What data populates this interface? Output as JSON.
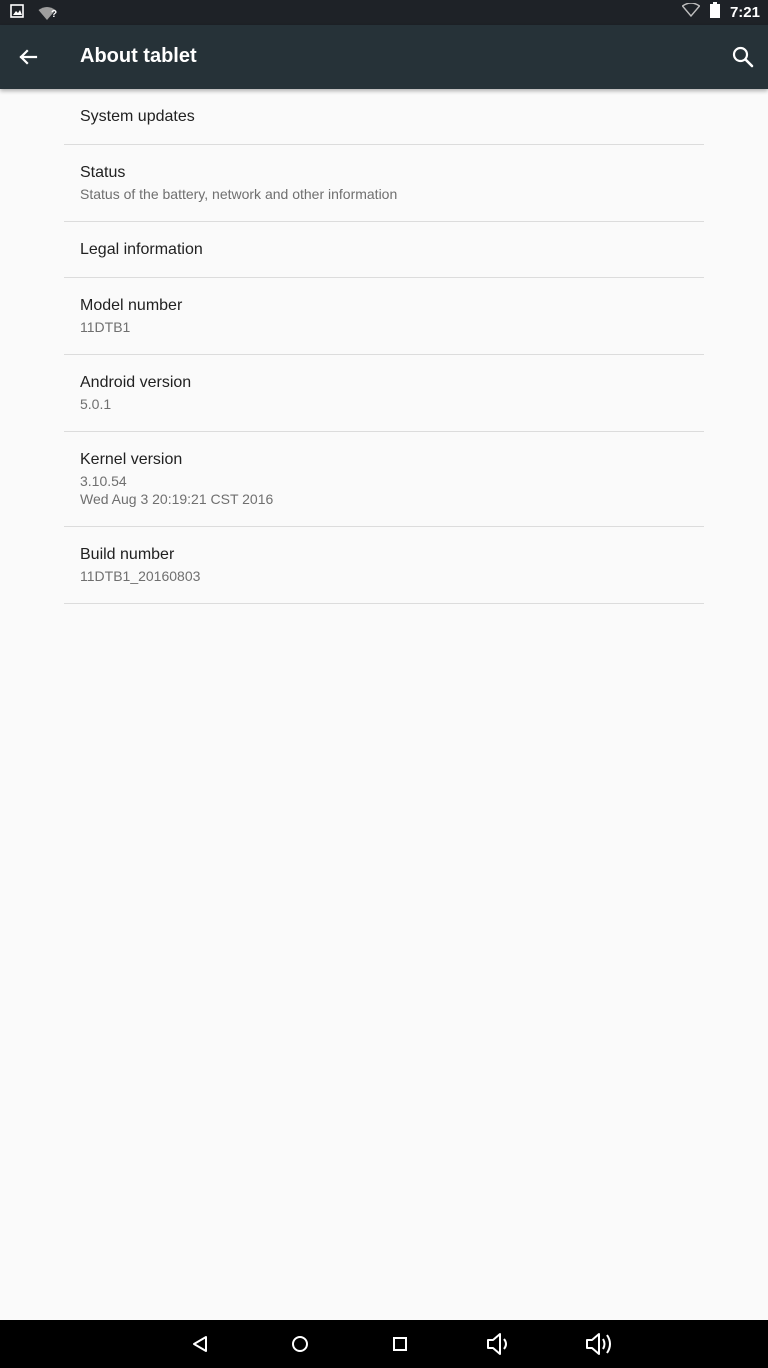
{
  "status_bar": {
    "time": "7:21",
    "left_icons": [
      "image-notification-icon",
      "wifi-unknown-icon"
    ],
    "wifi_unknown_mark": "?",
    "right_icons": [
      "wifi-icon",
      "battery-icon"
    ]
  },
  "app_bar": {
    "title": "About tablet",
    "back_icon": "arrow-back-icon",
    "search_icon": "search-icon",
    "background": "#263238"
  },
  "items": [
    {
      "title": "System updates"
    },
    {
      "title": "Status",
      "summary": "Status of the battery, network and other information"
    },
    {
      "title": "Legal information"
    },
    {
      "title": "Model number",
      "summary": "11DTB1"
    },
    {
      "title": "Android version",
      "summary": "5.0.1"
    },
    {
      "title": "Kernel version",
      "summary_line1": "3.10.54",
      "summary_line2": "Wed Aug 3 20:19:21 CST 2016"
    },
    {
      "title": "Build number",
      "summary": "11DTB1_20160803"
    }
  ],
  "nav_bar": {
    "buttons": [
      "back-triangle-icon",
      "home-circle-icon",
      "recents-square-icon",
      "volume-down-icon",
      "volume-up-icon"
    ]
  }
}
